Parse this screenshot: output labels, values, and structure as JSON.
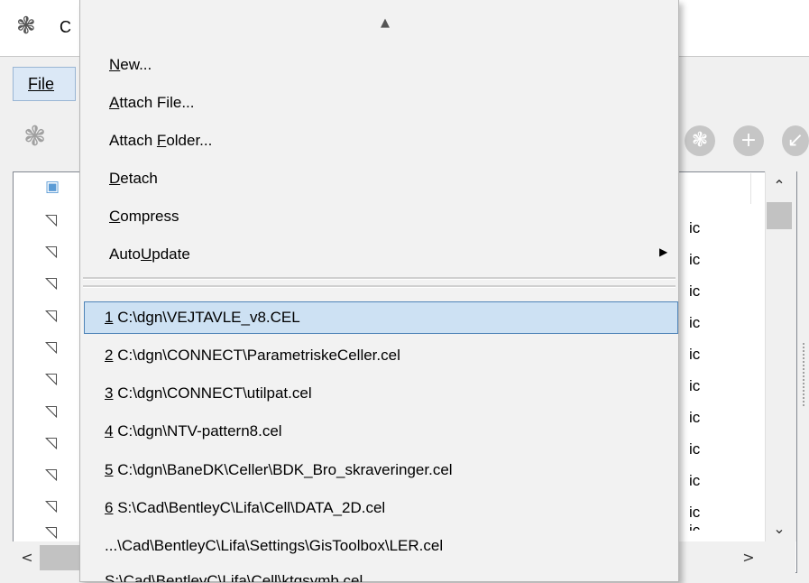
{
  "window": {
    "title_fragment": "C",
    "menubar": {
      "file": "File"
    }
  },
  "list": {
    "suffixes": [
      "ic",
      "ic",
      "ic",
      "ic",
      "ic",
      "ic",
      "ic",
      "ic",
      "ic",
      "ic",
      "ic"
    ]
  },
  "menu": {
    "items": [
      {
        "label": "New...",
        "accel": "N"
      },
      {
        "label": "Attach File...",
        "accel": "A"
      },
      {
        "label": "Attach Folder...",
        "accel": "F"
      },
      {
        "label": "Detach",
        "accel": "D"
      },
      {
        "label": "Compress",
        "accel": "C"
      },
      {
        "label": "AutoUpdate",
        "accel": "U"
      }
    ],
    "recent_files": [
      {
        "num": "1",
        "path": "C:\\dgn\\VEJTAVLE_v8.CEL"
      },
      {
        "num": "2",
        "path": "C:\\dgn\\CONNECT\\ParametriskeCeller.cel"
      },
      {
        "num": "3",
        "path": "C:\\dgn\\CONNECT\\utilpat.cel"
      },
      {
        "num": "4",
        "path": "C:\\dgn\\NTV-pattern8.cel"
      },
      {
        "num": "5",
        "path": "C:\\dgn\\BaneDK\\Celler\\BDK_Bro_skraveringer.cel"
      },
      {
        "num": "6",
        "path": "S:\\Cad\\BentleyC\\Lifa\\Cell\\DATA_2D.cel"
      },
      {
        "num": "",
        "path": "...\\Cad\\BentleyC\\Lifa\\Settings\\GisToolbox\\LER.cel"
      },
      {
        "num": "",
        "path": "S:\\Cad\\BentleyC\\Lifa\\Cell\\ktgsymb.cel"
      }
    ]
  },
  "colors": {
    "highlight": "#cde1f3",
    "highlight_border": "#4f84b8",
    "menu_bg": "#f2f2f2"
  }
}
